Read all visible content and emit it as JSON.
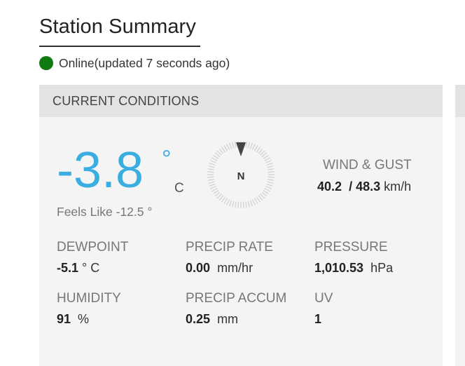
{
  "header": {
    "title": "Station Summary",
    "status_text": "Online(updated 7 seconds ago)"
  },
  "card": {
    "title": "CURRENT CONDITIONS",
    "temperature": {
      "value": "-3.8",
      "degree": "°",
      "unit": "C",
      "feels_like": "Feels Like -12.5 °"
    },
    "compass": {
      "direction": "N"
    },
    "wind": {
      "label": "WIND & GUST",
      "wind": "40.2",
      "separator": "/",
      "gust": "48.3",
      "unit": "km/h"
    },
    "stats": [
      {
        "label": "DEWPOINT",
        "value": "-5.1",
        "unit": "° C"
      },
      {
        "label": "PRECIP RATE",
        "value": "0.00",
        "unit": "mm/hr"
      },
      {
        "label": "PRESSURE",
        "value": "1,010.53",
        "unit": "hPa"
      },
      {
        "label": "HUMIDITY",
        "value": "91",
        "unit": "%"
      },
      {
        "label": "PRECIP ACCUM",
        "value": "0.25",
        "unit": "mm"
      },
      {
        "label": "UV",
        "value": "1",
        "unit": ""
      }
    ]
  },
  "colors": {
    "status_online": "#0f7a0f",
    "temperature": "#3aaee0",
    "card_background": "#f4f4f4",
    "card_header": "#e3e3e3"
  },
  "icons": {
    "status": "status-online-dot",
    "compass": "wind-compass-icon",
    "pointer": "wind-direction-pointer"
  }
}
